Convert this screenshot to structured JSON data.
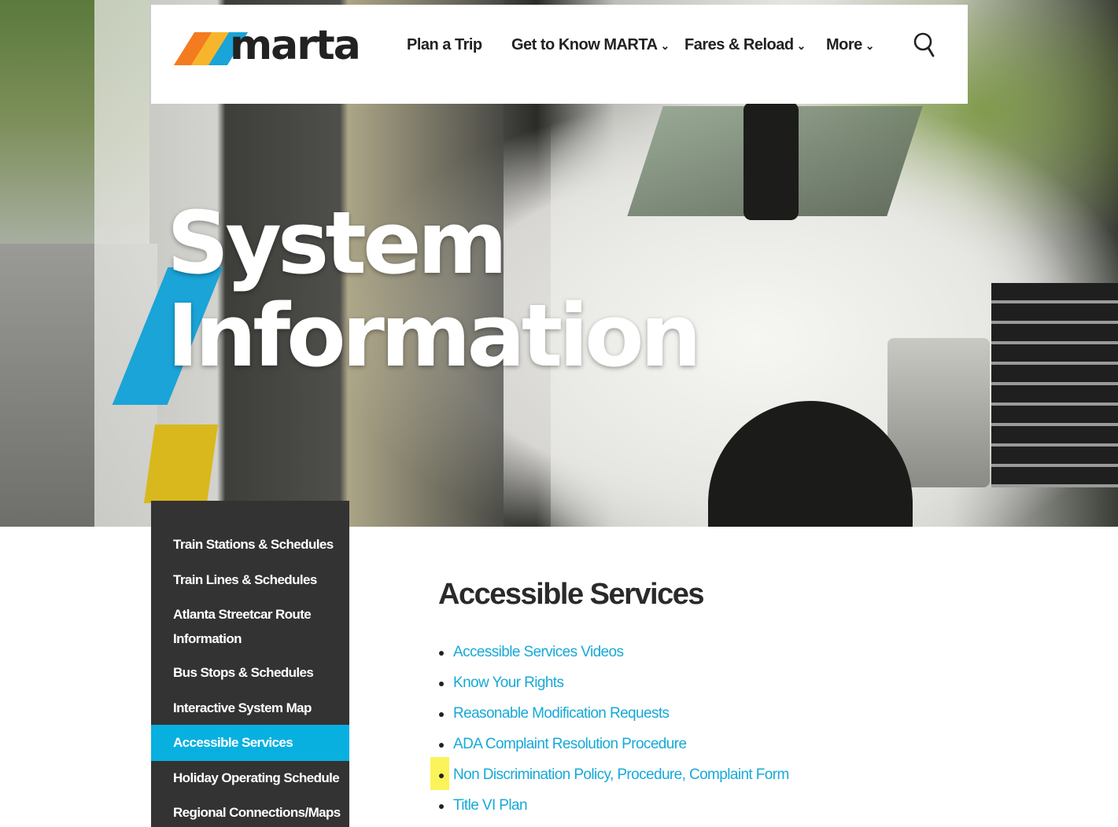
{
  "brand": {
    "logo_text": "marta",
    "colors": {
      "orange": "#f47b20",
      "yellow": "#f7b52c",
      "blue": "#1aa4d8",
      "link": "#16a9d8",
      "active_bg": "#08b0e0",
      "sidebar_bg": "#333333"
    }
  },
  "header": {
    "nav": [
      {
        "label": "Plan a Trip",
        "has_dropdown": false
      },
      {
        "label": "Get to Know MARTA",
        "has_dropdown": true
      },
      {
        "label": "Fares & Reload",
        "has_dropdown": true
      },
      {
        "label": "More",
        "has_dropdown": true
      }
    ],
    "search_icon": "search-icon",
    "chevron_glyph": "⌄"
  },
  "hero": {
    "title_line1": "System",
    "title_line2": "Information"
  },
  "sidebar": {
    "items": [
      {
        "label": "Train Stations & Schedules"
      },
      {
        "label": "Train Lines & Schedules"
      },
      {
        "label": "Atlanta Streetcar Route",
        "label2": "Information"
      },
      {
        "label": "Bus Stops & Schedules"
      },
      {
        "label": "Interactive System Map"
      },
      {
        "label": "Accessible Services",
        "active": true
      },
      {
        "label": "Holiday Operating Schedule"
      },
      {
        "label": "Regional Connections/Maps"
      }
    ]
  },
  "main": {
    "title": "Accessible Services",
    "links": [
      "Accessible Services Videos",
      "Know Your Rights",
      "Reasonable Modification Requests",
      "ADA Complaint Resolution Procedure",
      "Non Discrimination Policy, Procedure, Complaint Form",
      "Title VI Plan"
    ],
    "highlighted_bullet_index": 4
  }
}
